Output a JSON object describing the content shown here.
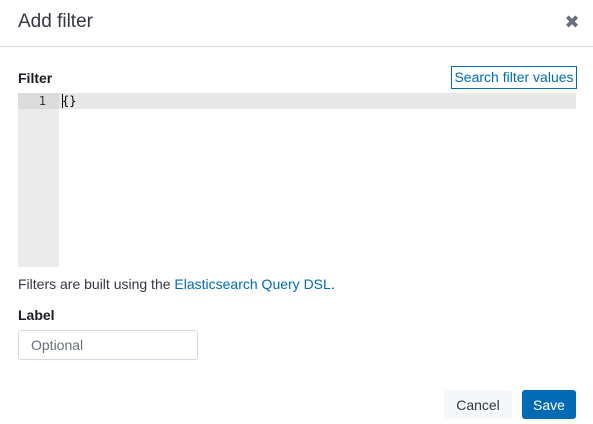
{
  "dialog": {
    "title": "Add filter",
    "close_icon": "close-icon"
  },
  "filter": {
    "label": "Filter",
    "search_link": "Search filter values",
    "editor": {
      "line_number": "1",
      "content": "{}"
    },
    "help_prefix": "Filters are built using the ",
    "help_link": "Elasticsearch Query DSL",
    "help_suffix": "."
  },
  "label_field": {
    "label": "Label",
    "value": "",
    "placeholder": "Optional"
  },
  "footer": {
    "cancel_label": "Cancel",
    "save_label": "Save"
  },
  "colors": {
    "accent": "#006bb4",
    "text": "#343741"
  }
}
